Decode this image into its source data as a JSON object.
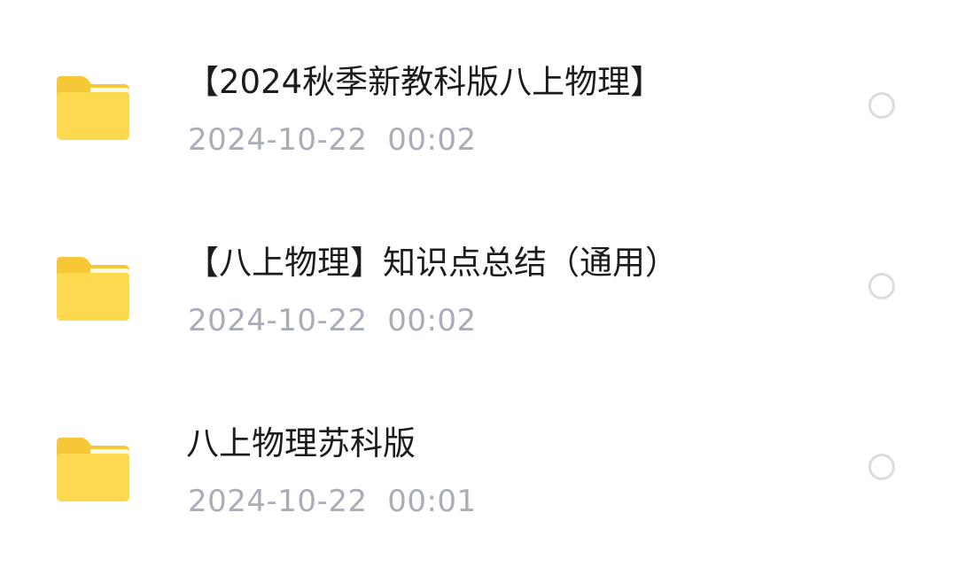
{
  "files": [
    {
      "name": "【2024秋季新教科版八上物理】",
      "date": "2024-10-22  00:02",
      "icon": "folder-icon",
      "selected": false
    },
    {
      "name": "【八上物理】知识点总结（通用）",
      "date": "2024-10-22  00:02",
      "icon": "folder-icon",
      "selected": false
    },
    {
      "name": "八上物理苏科版",
      "date": "2024-10-22  00:01",
      "icon": "folder-icon",
      "selected": false
    }
  ],
  "colors": {
    "folder_back": "#f6c736",
    "folder_front": "#fdd94f",
    "name_text": "#1c1c1e",
    "date_text": "#a9adb8",
    "radio_border": "#dcdcdc"
  }
}
